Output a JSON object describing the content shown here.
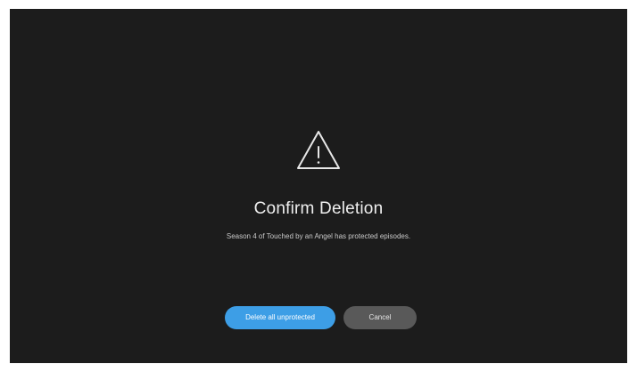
{
  "dialog": {
    "icon": "warning-triangle-icon",
    "title": "Confirm Deletion",
    "message": "Season 4 of Touched by an Angel has protected episodes.",
    "buttons": {
      "primary_label": "Delete all unprotected",
      "secondary_label": "Cancel"
    }
  },
  "colors": {
    "background": "#1c1c1c",
    "primary_button": "#3d9ee6",
    "secondary_button": "#595959",
    "text": "#eeeeee"
  }
}
